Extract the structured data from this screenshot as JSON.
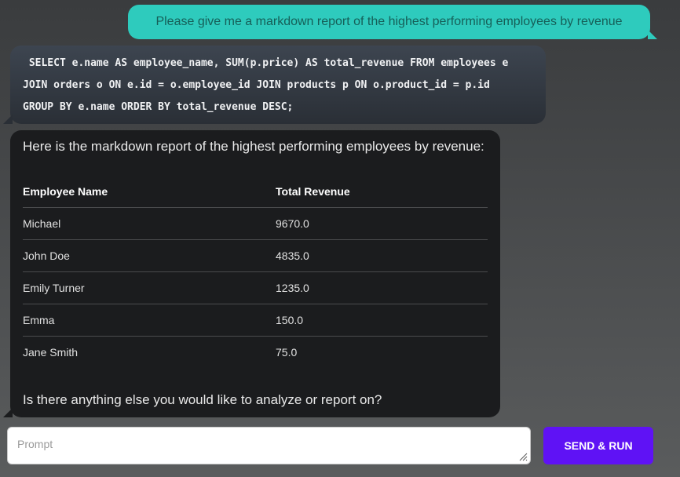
{
  "conversation": {
    "user_message": "Please give me a markdown report of the highest performing employees by revenue",
    "sql_lines": [
      " SELECT e.name AS employee_name, SUM(p.price) AS total_revenue FROM employees e",
      "JOIN orders o ON e.id = o.employee_id JOIN products p ON o.product_id = p.id",
      "GROUP BY e.name ORDER BY total_revenue DESC;"
    ],
    "report": {
      "intro": "Here is the markdown report of the highest performing employees by revenue:",
      "headers": [
        "Employee Name",
        "Total Revenue"
      ],
      "rows": [
        [
          "Michael",
          "9670.0"
        ],
        [
          "John Doe",
          "4835.0"
        ],
        [
          "Emily Turner",
          "1235.0"
        ],
        [
          "Emma",
          "150.0"
        ],
        [
          "Jane Smith",
          "75.0"
        ]
      ],
      "outro": "Is there anything else you would like to analyze or report on?"
    }
  },
  "input": {
    "placeholder": "Prompt",
    "value": ""
  },
  "send_button": {
    "label": "SEND & RUN"
  },
  "colors": {
    "user_bubble": "#2ecbbd",
    "sql_bubble": "#2f353d",
    "report_bubble": "#1b1c1e",
    "send_button": "#5f12f5"
  }
}
